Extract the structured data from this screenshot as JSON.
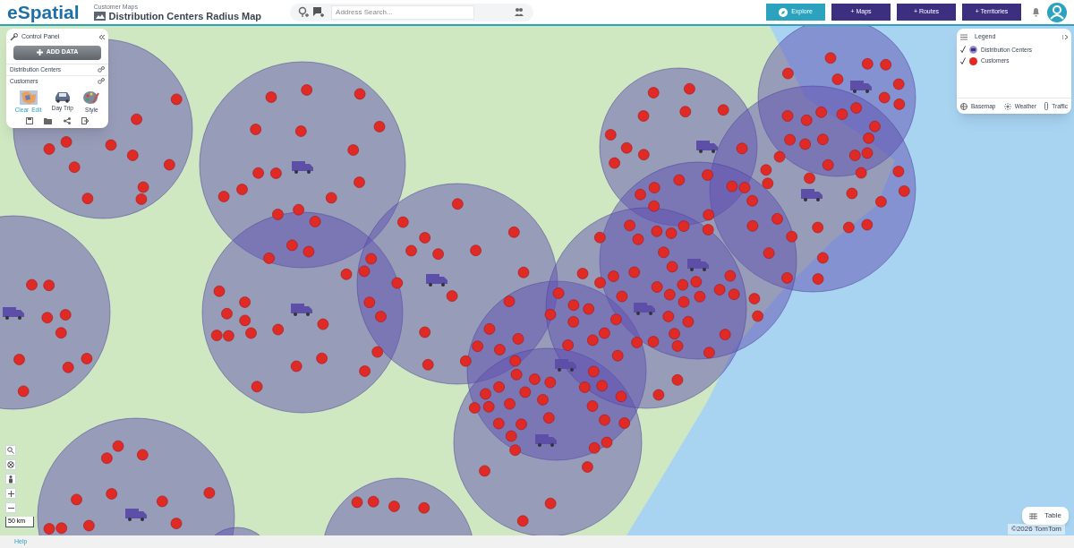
{
  "header": {
    "logo": "eSpatial",
    "breadcrumb": "Customer Maps",
    "map_title": "Distribution Centers Radius Map",
    "search": {
      "placeholder": "Address Search..."
    },
    "buttons": [
      {
        "label": "Explore",
        "kind": "primary"
      },
      {
        "label": "+ Maps",
        "kind": "secondary"
      },
      {
        "label": "+ Routes",
        "kind": "secondary"
      },
      {
        "label": "+ Territories",
        "kind": "secondary"
      }
    ]
  },
  "control_panel": {
    "title": "Control Panel",
    "add_button": "ADD DATA",
    "layers": [
      "Distribution Centers",
      "Customers"
    ],
    "tools": [
      {
        "kind": "split",
        "labels": [
          "Clear",
          "Edit"
        ]
      },
      {
        "kind": "car",
        "labels": [
          "Day Trip"
        ]
      },
      {
        "kind": "palette",
        "labels": [
          "Style"
        ]
      }
    ]
  },
  "legend": {
    "title": "Legend",
    "items": [
      {
        "label": "Distribution Centers",
        "kind": "truck",
        "color": "#8f87c8"
      },
      {
        "label": "Customers",
        "kind": "dot",
        "color": "#e02a26"
      }
    ],
    "tabs": [
      "Basemap",
      "Weather",
      "Traffic"
    ]
  },
  "map": {
    "scale": "50 km",
    "copyright": "©2026 TomTom",
    "table_button": "Table"
  },
  "footer": {
    "help": "Help"
  }
}
